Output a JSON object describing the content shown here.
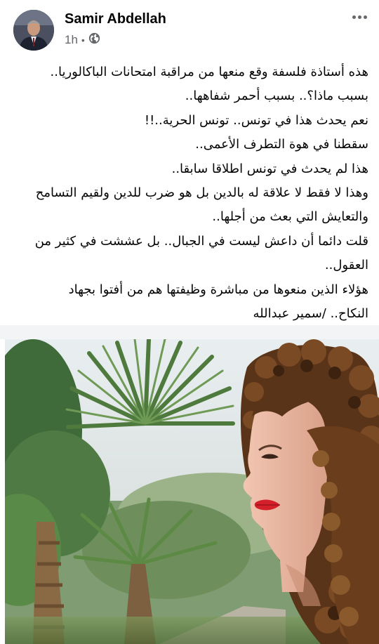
{
  "post": {
    "author": {
      "name": "Samir Abdellah"
    },
    "meta": {
      "time": "1h",
      "separator": "•",
      "audience_icon": "globe-icon"
    },
    "more_icon": "more-options-icon",
    "text_lines": [
      "هذه أستاذة فلسفة وقع منعها من مراقبة امتحانات الباكالوريا..",
      "بسبب ماذا؟.. بسبب أحمر شفاهها..",
      "نعم يحدث هذا في تونس.. تونس الحرية..!!",
      "سقطنا في هوة التطرف الأعمى..",
      "هذا لم يحدث في تونس اطلاقا سابقا..",
      "وهذا لا فقط لا علاقة له بالدين بل هو ضرب للدين ولقيم التسامح",
      "والتعايش التي بعث من أجلها..",
      "قلت دائما أن داعش ليست في الجبال.. بل عششت في كثير من",
      "العقول..",
      "هؤلاء الذين منعوها من مباشرة وظيفتها هم من أفتوا بجهاد",
      "النكاح.. /سمير عبدالله"
    ],
    "photo": {
      "subject": "woman-with-curly-hair-and-red-lipstick",
      "background": "palm-trees-garden"
    },
    "colors": {
      "text": "#050505",
      "meta": "#65676b",
      "divider": "#f3f4f5",
      "lipstick": "#d4202a"
    }
  }
}
